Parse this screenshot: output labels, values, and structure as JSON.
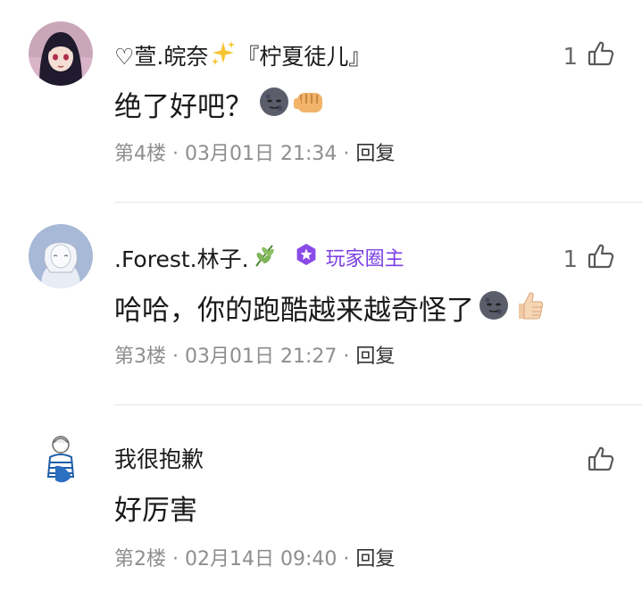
{
  "comments": [
    {
      "username": "♡萱.皖奈",
      "username_suffix": "『柠夏徒儿』",
      "likes": "1",
      "text": "绝了好吧？",
      "floor": "第4楼",
      "datetime": "03月01日 21:34",
      "reply_label": "回复"
    },
    {
      "username": ".Forest.林子.",
      "badge_label": "玩家圈主",
      "likes": "1",
      "text": "哈哈，你的跑酷越来越奇怪了",
      "floor": "第3楼",
      "datetime": "03月01日 21:27",
      "reply_label": "回复"
    },
    {
      "username": "我很抱歉",
      "text": "好厉害",
      "floor": "第2楼",
      "datetime": "02月14日 09:40",
      "reply_label": "回复"
    }
  ],
  "meta_separator": "·",
  "colors": {
    "badge": "#7b3fe4",
    "meta": "#8e8e8e",
    "divider": "#e6e6e6"
  }
}
